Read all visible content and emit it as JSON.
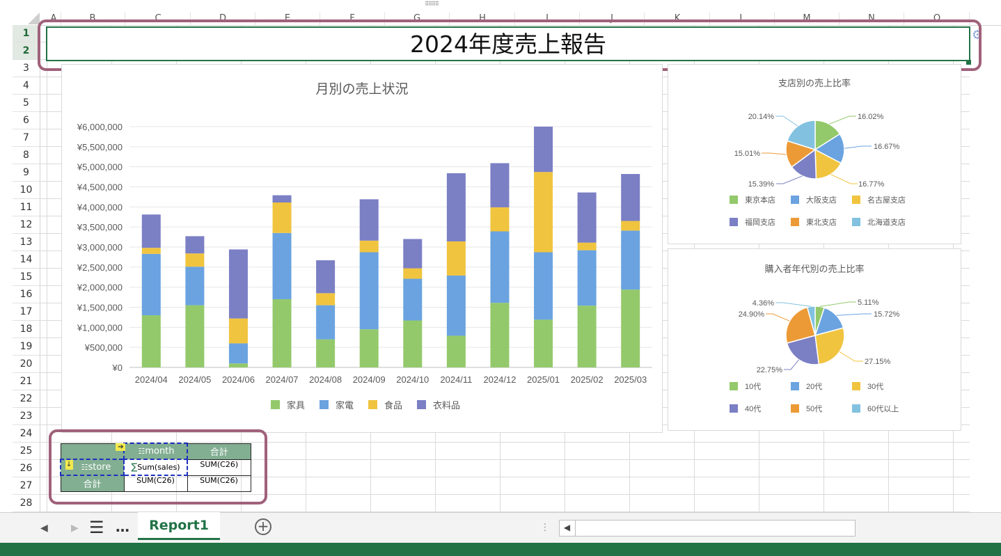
{
  "columns": [
    "A",
    "B",
    "C",
    "D",
    "E",
    "F",
    "G",
    "H",
    "I",
    "J",
    "K",
    "L",
    "M",
    "N",
    "O"
  ],
  "rows": [
    "1",
    "2",
    "3",
    "4",
    "5",
    "6",
    "7",
    "8",
    "9",
    "10",
    "11",
    "12",
    "13",
    "14",
    "15",
    "16",
    "17",
    "18",
    "19",
    "20",
    "21",
    "22",
    "23",
    "24",
    "25",
    "26",
    "27",
    "28"
  ],
  "title": "2024年度売上報告",
  "colors": {
    "accent": "#217346",
    "highlight_frame": "#a0617a",
    "table_header": "#82ae92",
    "series": [
      "#93c96b",
      "#6aa3e0",
      "#f0c43f",
      "#7b7fc4",
      "#ec9a36",
      "#82c1e0"
    ]
  },
  "chart_data": [
    {
      "type": "bar",
      "stacked": true,
      "title": "月別の売上状況",
      "categories": [
        "2024/04",
        "2024/05",
        "2024/06",
        "2024/07",
        "2024/08",
        "2024/09",
        "2024/10",
        "2024/11",
        "2024/12",
        "2025/01",
        "2025/02",
        "2025/03"
      ],
      "series": [
        {
          "name": "家具",
          "values": [
            1300000,
            1550000,
            100000,
            1700000,
            700000,
            950000,
            1170000,
            790000,
            1610000,
            1190000,
            1540000,
            1940000
          ]
        },
        {
          "name": "家電",
          "values": [
            1530000,
            960000,
            500000,
            1650000,
            850000,
            1920000,
            1040000,
            1500000,
            1780000,
            1680000,
            1380000,
            1470000
          ]
        },
        {
          "name": "食品",
          "values": [
            150000,
            330000,
            620000,
            760000,
            300000,
            290000,
            260000,
            850000,
            600000,
            2000000,
            190000,
            240000
          ]
        },
        {
          "name": "衣料品",
          "values": [
            830000,
            430000,
            1720000,
            180000,
            820000,
            1030000,
            730000,
            1700000,
            1100000,
            1130000,
            1250000,
            1170000
          ]
        }
      ],
      "y_ticks": [
        "¥0",
        "¥500,000",
        "¥1,000,000",
        "¥1,500,000",
        "¥2,000,000",
        "¥2,500,000",
        "¥3,000,000",
        "¥3,500,000",
        "¥4,000,000",
        "¥4,500,000",
        "¥5,000,000",
        "¥5,500,000",
        "¥6,000,000"
      ],
      "ylim": [
        0,
        6000000
      ],
      "legend": "bottom",
      "grid": true
    },
    {
      "type": "pie",
      "title": "支店別の売上比率",
      "categories": [
        "東京本店",
        "大阪支店",
        "名古屋支店",
        "福岡支店",
        "東北支店",
        "北海道支店"
      ],
      "values": [
        16.02,
        16.67,
        16.77,
        15.39,
        15.01,
        20.14
      ],
      "labels": [
        "16.02%",
        "16.67%",
        "16.77%",
        "15.39%",
        "15.01%",
        "20.14%"
      ],
      "legend": "bottom"
    },
    {
      "type": "pie",
      "title": "購入者年代別の売上比率",
      "categories": [
        "10代",
        "20代",
        "30代",
        "40代",
        "50代",
        "60代以上"
      ],
      "values": [
        5.11,
        15.72,
        27.15,
        22.75,
        24.9,
        4.36
      ],
      "labels": [
        "5.11%",
        "15.72%",
        "27.15%",
        "22.75%",
        "24.90%",
        "4.36%"
      ],
      "legend": "bottom"
    }
  ],
  "pivot": {
    "col_field": "month",
    "row_field": "store",
    "value_field": "Sum(sales)",
    "total_label": "合計",
    "sum_formula": "SUM(C26)"
  },
  "sheet_tabs": {
    "active": "Report1",
    "menu": "☰",
    "more": "…",
    "add": "+"
  }
}
